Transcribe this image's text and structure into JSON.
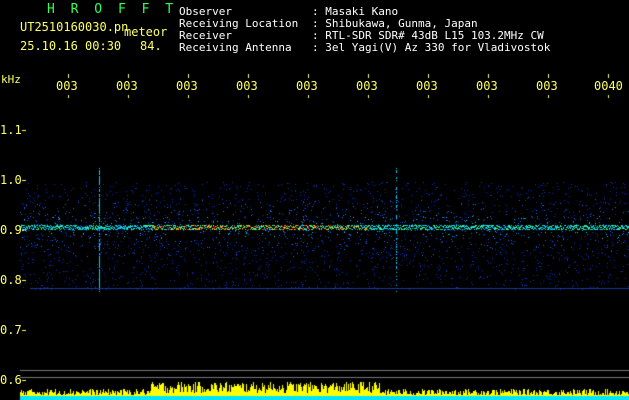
{
  "header": {
    "brand": "H R O F F T",
    "filename": "UT2510160030.pn",
    "type": "meteor",
    "datetime": "25.10.16 00:30",
    "count": "84.",
    "fields": [
      {
        "label": "Observer",
        "value": ": Masaki Kano"
      },
      {
        "label": "Receiving Location",
        "value": ": Shibukawa, Gunma, Japan"
      },
      {
        "label": "Receiver",
        "value": ": RTL-SDR SDR# 43dB L15 103.2MHz CW"
      },
      {
        "label": "Receiving Antenna",
        "value": ": 3el Yagi(V) Az 330 for Vladivostok"
      }
    ]
  },
  "axis": {
    "unit": "kHz",
    "y_ticks": [
      "1.1",
      "1.0",
      "0.9",
      "0.8",
      "0.7",
      "0.6"
    ],
    "x_ticks": [
      "003",
      "003",
      "003",
      "003",
      "003",
      "003",
      "003",
      "003",
      "003",
      "0040"
    ]
  },
  "colors": {
    "background": "#000000",
    "text_yellow": "#ffff66",
    "brand_green": "#33ff55",
    "signal_low": "#0033cc",
    "signal_mid": "#00ccff",
    "signal_high": "#ff3300",
    "activity_bar": "#ffff00",
    "baseline": "#00e5ff"
  }
}
